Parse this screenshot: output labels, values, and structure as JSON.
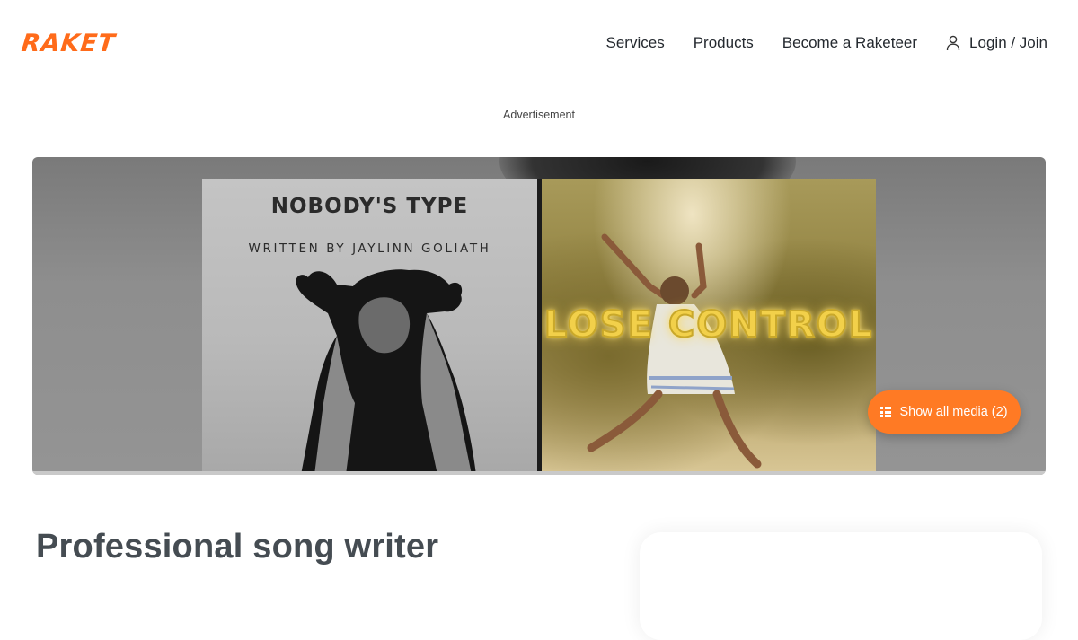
{
  "header": {
    "logo_text": "RAKET",
    "brand_color": "#ff6b1a",
    "nav": {
      "services": "Services",
      "products": "Products",
      "become": "Become a Raketeer",
      "login": "Login / Join",
      "login_icon": "user-icon"
    }
  },
  "ad": {
    "label": "Advertisement"
  },
  "gallery": {
    "cover_left": {
      "title": "NOBODY'S TYPE",
      "subtitle": "WRITTEN BY JAYLINN GOLIATH"
    },
    "cover_right": {
      "title": "LOSE CONTROL"
    },
    "show_media": {
      "label": "Show all media (2)",
      "icon": "grid-icon",
      "color": "#ff7a24"
    }
  },
  "main": {
    "title": "Professional song writer"
  }
}
